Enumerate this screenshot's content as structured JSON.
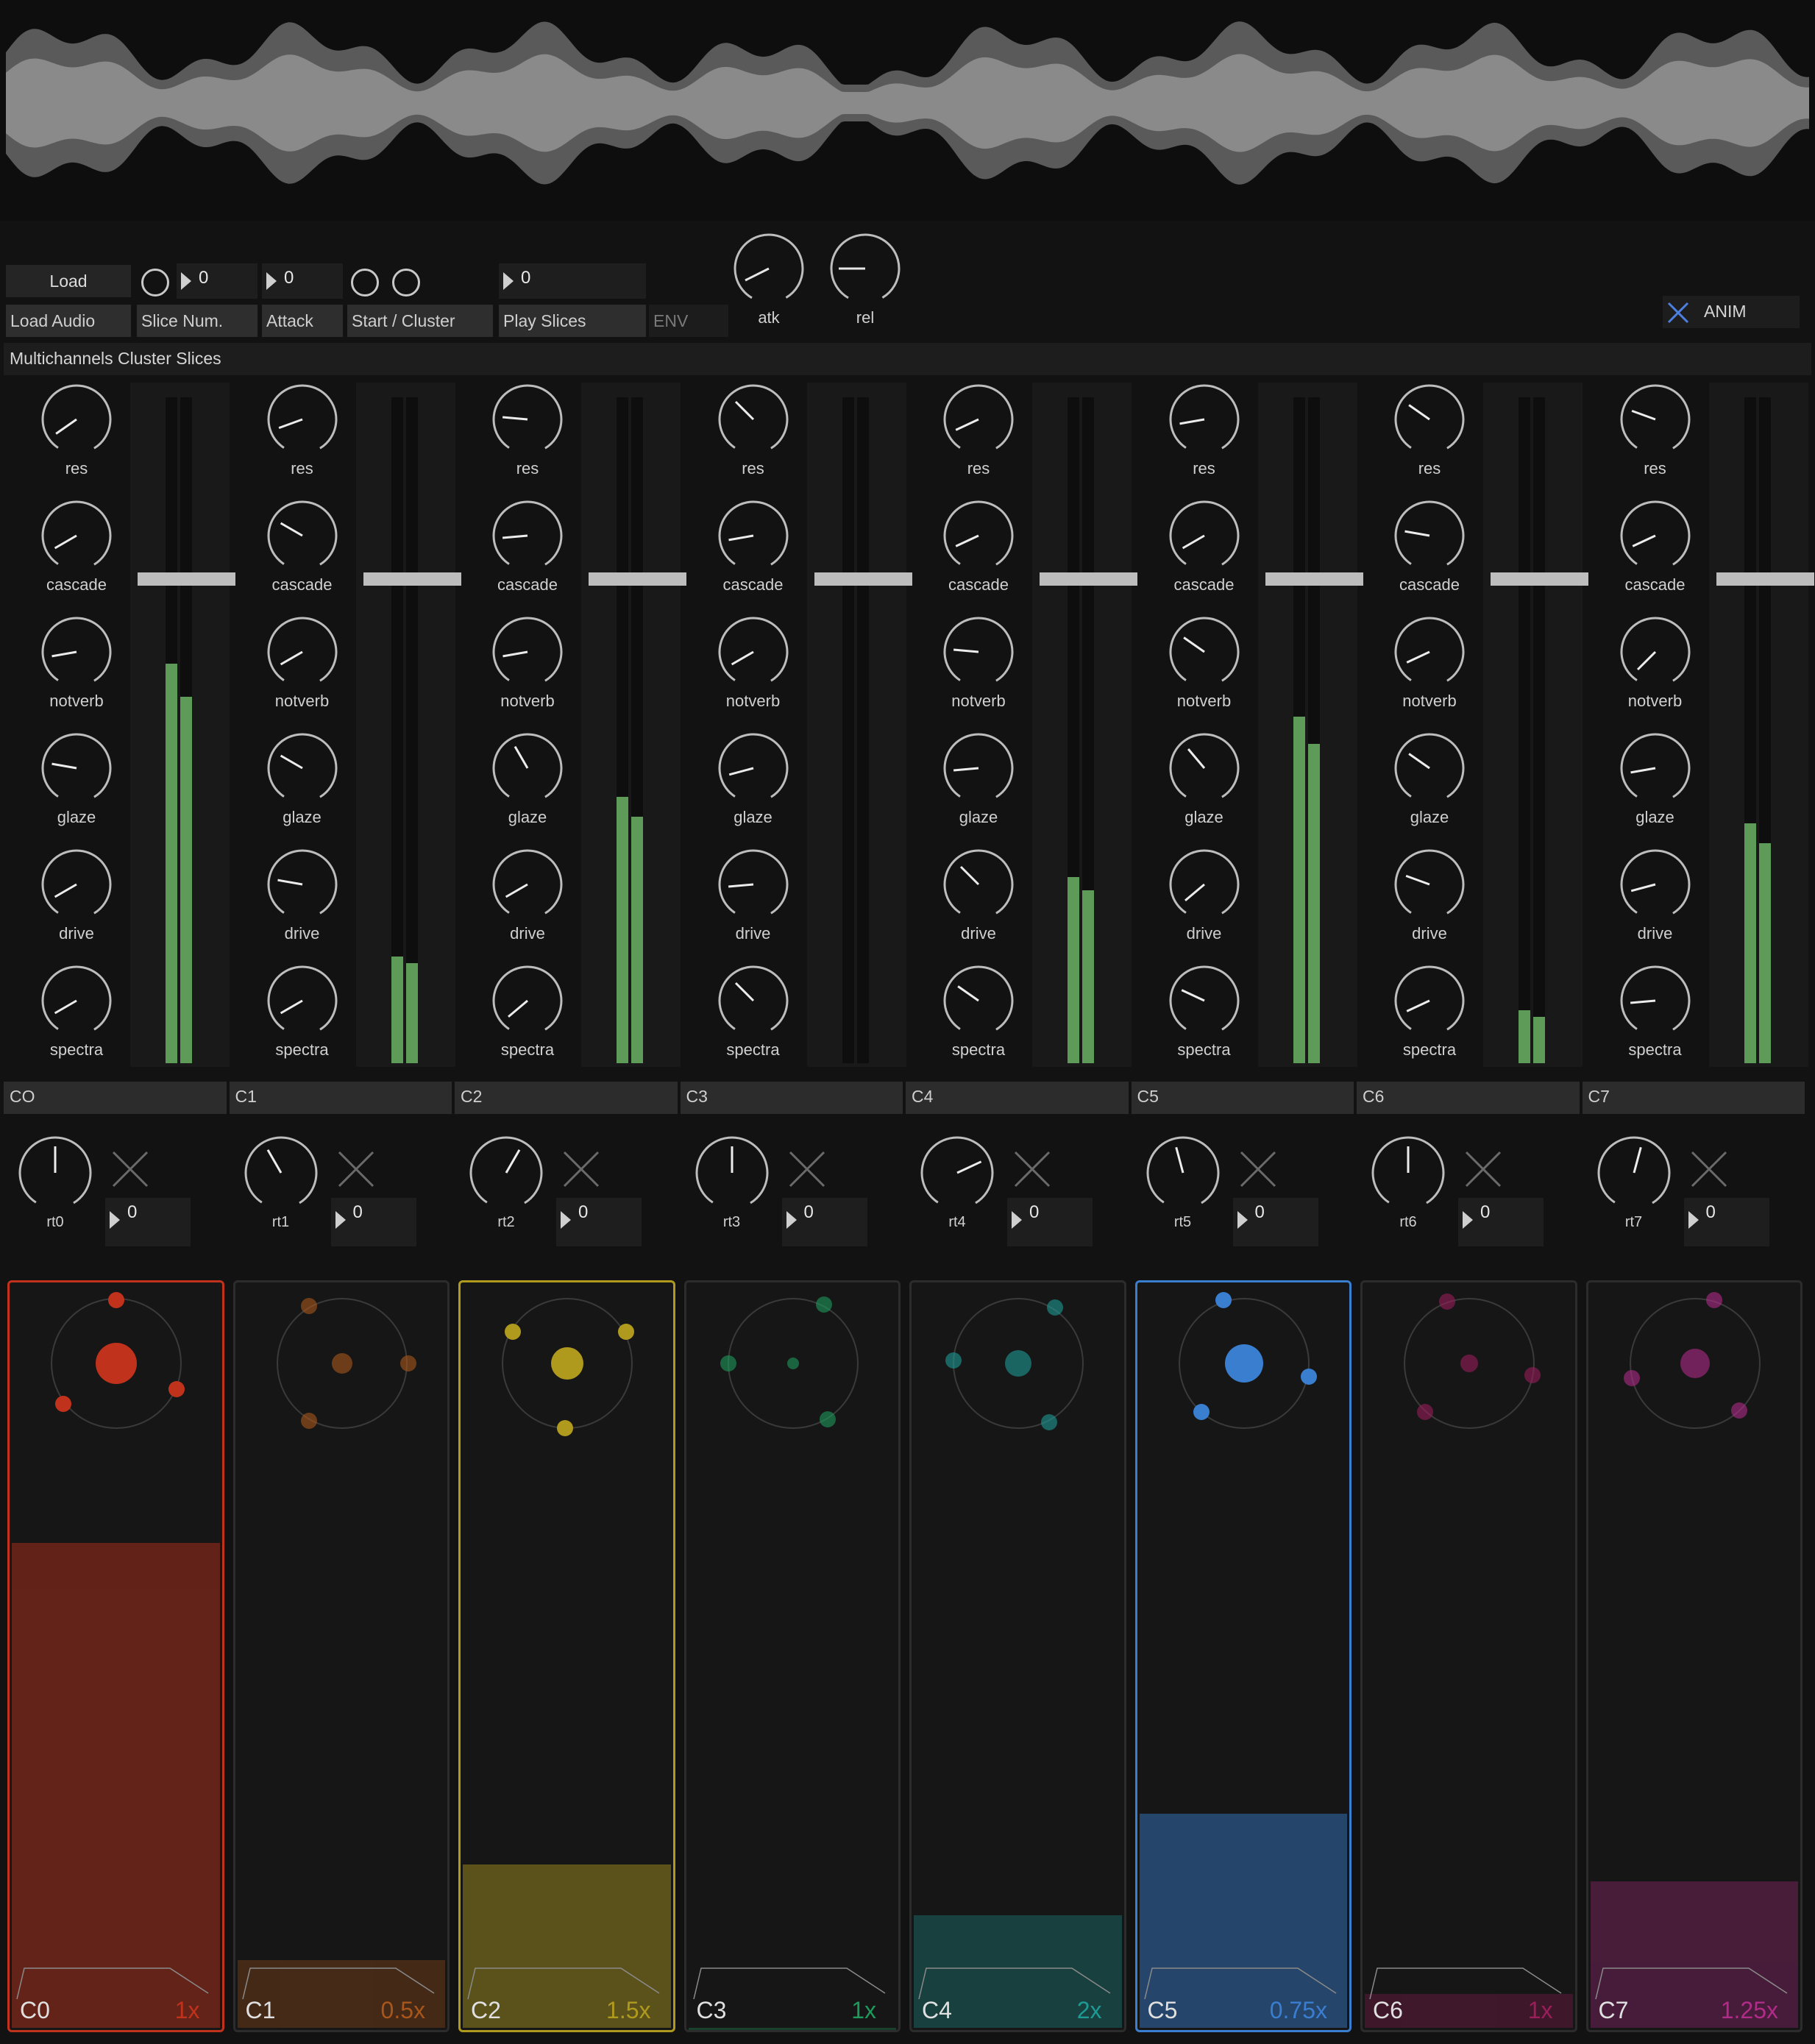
{
  "waveform": {
    "label": "audio-waveform-display"
  },
  "top_controls": {
    "load_button": "Load",
    "load_label": "Load Audio",
    "slice_num_value": "0",
    "slice_num_label": "Slice Num.",
    "attack_value": "0",
    "attack_label": "Attack",
    "start_cluster_label": "Start / Cluster",
    "play_slices_value": "0",
    "play_slices_label": "Play Slices",
    "env_label": "ENV",
    "atk_label": "atk",
    "rel_label": "rel",
    "anim_label": "ANIM"
  },
  "header": {
    "title": "Multichannels Cluster Slices"
  },
  "knob_labels": [
    "res",
    "cascade",
    "notverb",
    "glaze",
    "drive",
    "spectra"
  ],
  "strips": [
    {
      "label": "CO",
      "rt_label": "rt0",
      "rt_value": "0",
      "meter": [
        0.6,
        0.55
      ]
    },
    {
      "label": "C1",
      "rt_label": "rt1",
      "rt_value": "0",
      "meter": [
        0.16,
        0.15
      ]
    },
    {
      "label": "C2",
      "rt_label": "rt2",
      "rt_value": "0",
      "meter": [
        0.4,
        0.37
      ]
    },
    {
      "label": "C3",
      "rt_label": "rt3",
      "rt_value": "0",
      "meter": [
        0.0,
        0.0
      ]
    },
    {
      "label": "C4",
      "rt_label": "rt4",
      "rt_value": "0",
      "meter": [
        0.28,
        0.26
      ]
    },
    {
      "label": "C5",
      "rt_label": "rt5",
      "rt_value": "0",
      "meter": [
        0.52,
        0.48
      ]
    },
    {
      "label": "C6",
      "rt_label": "rt6",
      "rt_value": "0",
      "meter": [
        0.08,
        0.07
      ]
    },
    {
      "label": "C7",
      "rt_label": "rt7",
      "rt_value": "0",
      "meter": [
        0.36,
        0.33
      ]
    }
  ],
  "cards": [
    {
      "name": "C0",
      "rate": "1x",
      "color": "#c0321c",
      "level": 0.86,
      "active": true
    },
    {
      "name": "C1",
      "rate": "0.5x",
      "color": "#a8561c",
      "level": 0.12,
      "active": false
    },
    {
      "name": "C2",
      "rate": "1.5x",
      "color": "#b09a1e",
      "level": 0.29,
      "active": true
    },
    {
      "name": "C3",
      "rate": "1x",
      "color": "#1e9a5c",
      "level": 0.0,
      "active": false
    },
    {
      "name": "C4",
      "rate": "2x",
      "color": "#1e9a94",
      "level": 0.2,
      "active": false
    },
    {
      "name": "C5",
      "rate": "0.75x",
      "color": "#3a7ed0",
      "level": 0.38,
      "active": true
    },
    {
      "name": "C6",
      "rate": "1x",
      "color": "#9a1e5a",
      "level": 0.06,
      "active": false
    },
    {
      "name": "C7",
      "rate": "1.25x",
      "color": "#b02c88",
      "level": 0.26,
      "active": false
    }
  ]
}
